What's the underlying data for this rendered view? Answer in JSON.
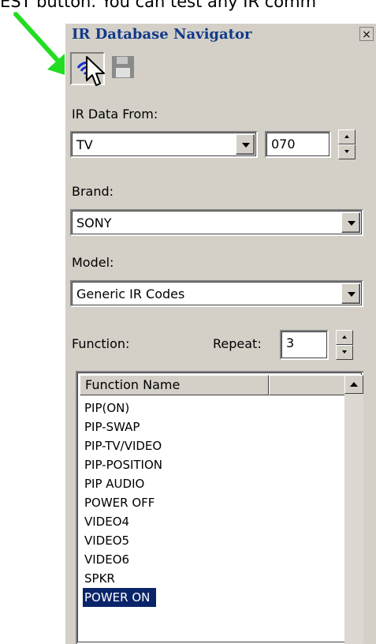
{
  "caption": "EST button. You can test any IR comm",
  "window": {
    "title": "IR Database Navigator",
    "close_glyph": "×"
  },
  "toolbar": {
    "test_icon": "ir-signal-icon",
    "save_icon": "floppy-disk-icon"
  },
  "ir_data_from": {
    "label": "IR Data From:",
    "device_value": "TV",
    "code_value": "070"
  },
  "brand": {
    "label": "Brand:",
    "value": "SONY"
  },
  "model": {
    "label": "Model:",
    "value": "Generic IR Codes"
  },
  "function": {
    "label": "Function:",
    "repeat_label": "Repeat:",
    "repeat_value": "3"
  },
  "function_list": {
    "columns": [
      "Function Name",
      ""
    ],
    "rows": [
      "PIP(ON)",
      "PIP-SWAP",
      "PIP-TV/VIDEO",
      "PIP-POSITION",
      "PIP AUDIO",
      "POWER OFF",
      "VIDEO4",
      "VIDEO5",
      "VIDEO6",
      "SPKR",
      "POWER ON"
    ],
    "selected_row": "POWER ON"
  },
  "colors": {
    "panel": "#d4d0c8",
    "title_text": "#123a8a",
    "selection": "#0a246a",
    "pointer_arrow": "#22dd22"
  }
}
